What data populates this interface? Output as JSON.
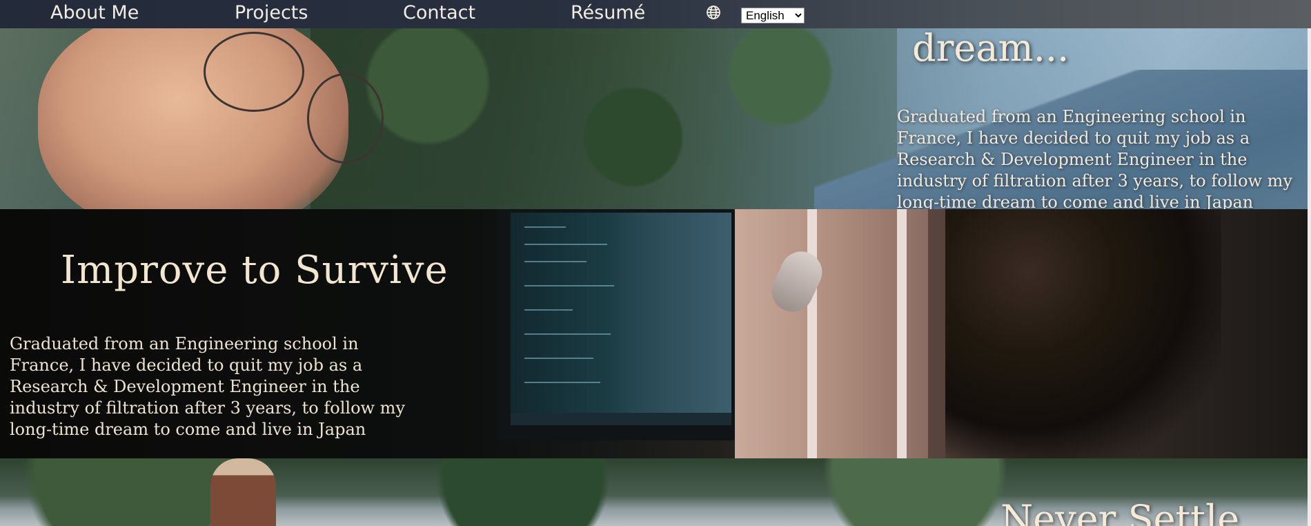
{
  "nav": {
    "items": [
      "About Me",
      "Projects",
      "Contact",
      "Résumé"
    ],
    "language_selected": "English"
  },
  "sections": [
    {
      "title": "dream...",
      "text": "Graduated from an Engineering school in France, I have decided to quit my job as a Research & Development Engineer in the industry of filtration after 3 years, to follow my long-time dream to come and live in Japan"
    },
    {
      "title": "Improve to Survive",
      "text": "Graduated from an Engineering school in France, I have decided to quit my job as a Research & Development Engineer in the industry of filtration after 3 years, to follow my long-time dream to come and live in Japan"
    },
    {
      "title": "Never Settle"
    }
  ],
  "colors": {
    "nav_text": "#f2ede4",
    "heading_text": "#f2e6d0",
    "body_text": "#eee3d1"
  }
}
